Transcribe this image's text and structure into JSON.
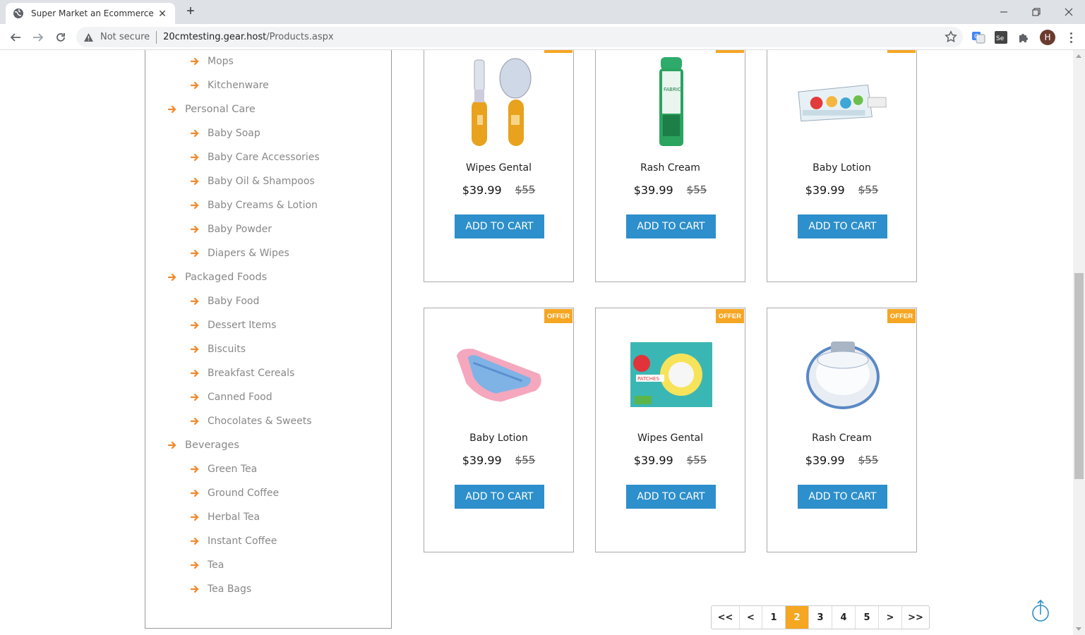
{
  "browser": {
    "tab_title": "Super Market an Ecommerce Onl",
    "not_secure": "Not secure",
    "url_host": "20cmtesting.gear.host",
    "url_path": "/Products.aspx",
    "avatar_letter": "H"
  },
  "sidebar": {
    "items": [
      {
        "label": "Mops",
        "level": 2
      },
      {
        "label": "Kitchenware",
        "level": 2
      },
      {
        "label": "Personal Care",
        "level": 1
      },
      {
        "label": "Baby Soap",
        "level": 2
      },
      {
        "label": "Baby Care Accessories",
        "level": 2
      },
      {
        "label": "Baby Oil & Shampoos",
        "level": 2
      },
      {
        "label": "Baby Creams & Lotion",
        "level": 2
      },
      {
        "label": "Baby Powder",
        "level": 2
      },
      {
        "label": "Diapers & Wipes",
        "level": 2
      },
      {
        "label": "Packaged Foods",
        "level": 1
      },
      {
        "label": "Baby Food",
        "level": 2
      },
      {
        "label": "Dessert Items",
        "level": 2
      },
      {
        "label": "Biscuits",
        "level": 2
      },
      {
        "label": "Breakfast Cereals",
        "level": 2
      },
      {
        "label": "Canned Food",
        "level": 2
      },
      {
        "label": "Chocolates & Sweets",
        "level": 2
      },
      {
        "label": "Beverages",
        "level": 1
      },
      {
        "label": "Green Tea",
        "level": 2
      },
      {
        "label": "Ground Coffee",
        "level": 2
      },
      {
        "label": "Herbal Tea",
        "level": 2
      },
      {
        "label": "Instant Coffee",
        "level": 2
      },
      {
        "label": "Tea",
        "level": 2
      },
      {
        "label": "Tea Bags",
        "level": 2
      }
    ]
  },
  "products": [
    {
      "name": "Wipes Gental",
      "price": "$39.99",
      "old_price": "$55",
      "offer": "OFFER",
      "image": "brush-comb-set",
      "button": "ADD TO CART"
    },
    {
      "name": "Rash Cream",
      "price": "$39.99",
      "old_price": "$55",
      "offer": "OFFER",
      "image": "roll-on-bottle",
      "button": "ADD TO CART"
    },
    {
      "name": "Baby Lotion",
      "price": "$39.99",
      "old_price": "$55",
      "offer": "OFFER",
      "image": "toothpaste-tube",
      "button": "ADD TO CART"
    },
    {
      "name": "Baby Lotion",
      "price": "$39.99",
      "old_price": "$55",
      "offer": "OFFER",
      "image": "baby-bather",
      "button": "ADD TO CART"
    },
    {
      "name": "Wipes Gental",
      "price": "$39.99",
      "old_price": "$55",
      "offer": "OFFER",
      "image": "patches-box",
      "button": "ADD TO CART"
    },
    {
      "name": "Rash Cream",
      "price": "$39.99",
      "old_price": "$55",
      "offer": "OFFER",
      "image": "powder-puff-container",
      "button": "ADD TO CART"
    }
  ],
  "pagination": {
    "items": [
      "<<",
      "<",
      "1",
      "2",
      "3",
      "4",
      "5",
      ">",
      ">>"
    ],
    "active": "2"
  },
  "colors": {
    "accent_orange": "#f5a623",
    "arrow_orange": "#f0892b",
    "button_blue": "#2d8fcb"
  }
}
